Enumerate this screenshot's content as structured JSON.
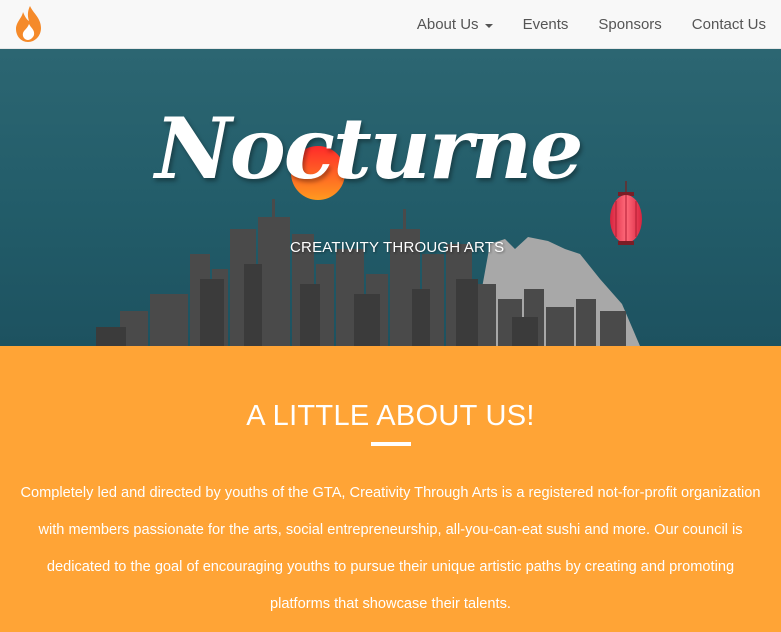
{
  "navbar": {
    "logo_icon": "flame-icon",
    "items": [
      {
        "label": "About Us",
        "has_dropdown": true
      },
      {
        "label": "Events"
      },
      {
        "label": "Sponsors"
      },
      {
        "label": "Contact Us"
      }
    ]
  },
  "hero": {
    "title": "Nocturne",
    "subtitle": "CREATIVITY THROUGH ARTS",
    "decorations": [
      "sun-icon",
      "lantern-icon",
      "city-skyline"
    ]
  },
  "about": {
    "heading": "A LITTLE ABOUT US!",
    "lines": [
      "Completely led and directed by youths of the GTA, Creativity Through Arts is a registered not-for-profit organization",
      "with members passionate for the arts, social entrepreneurship, all-you-can-eat sushi and more. Our council is",
      "dedicated to the goal of encouraging youths to pursue their unique artistic paths by creating and promoting",
      "platforms that showcase their talents."
    ]
  },
  "colors": {
    "brand_orange": "#ffa436",
    "hero_teal": "#245f6b",
    "navbar_bg": "#f8f8f8",
    "nav_text": "#555555"
  }
}
